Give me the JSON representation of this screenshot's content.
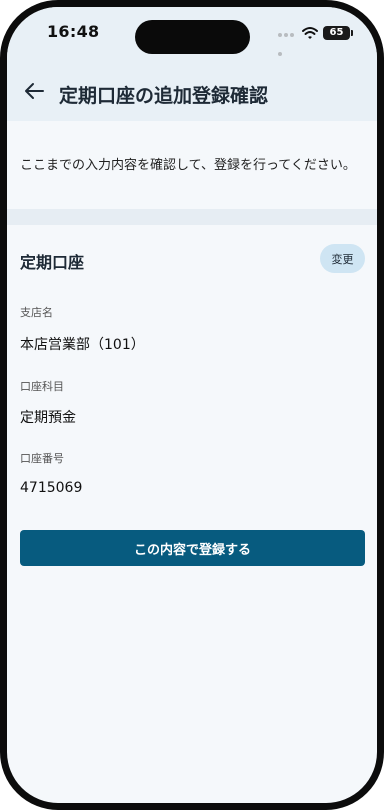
{
  "status_bar": {
    "time": "16:48",
    "battery": "65"
  },
  "header": {
    "title": "定期口座の追加登録確認"
  },
  "notice": "ここまでの入力内容を確認して、登録を行ってください。",
  "section": {
    "title": "定期口座",
    "change_label": "変更",
    "fields": [
      {
        "label": "支店名",
        "value": "本店営業部（101）"
      },
      {
        "label": "口座科目",
        "value": "定期預金"
      },
      {
        "label": "口座番号",
        "value": "4715069"
      }
    ]
  },
  "submit_label": "この内容で登録する",
  "colors": {
    "primary": "#075b7f",
    "header_bg": "#e8f0f6",
    "change_bg": "#cfe5f3"
  },
  "icons": {
    "back": "arrow-left-icon",
    "wifi": "wifi-icon"
  }
}
